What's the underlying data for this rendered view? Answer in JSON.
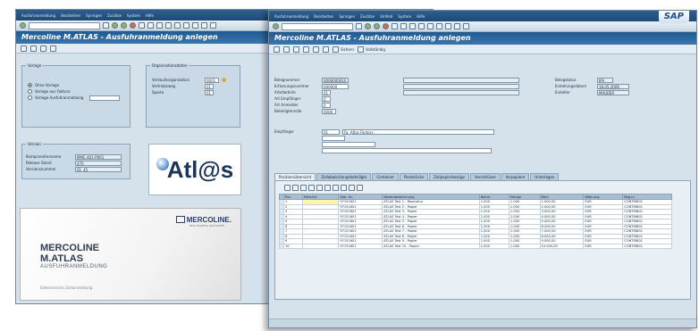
{
  "back_window": {
    "menu": [
      "Ausfuhranmeldung",
      "Bearbeiten",
      "Springen",
      "Zusätze",
      "System",
      "Hilfe"
    ],
    "title": "Mercoline M.ATLAS - Ausfuhranmeldung anlegen",
    "vorlage": {
      "group_title": "Vorlage",
      "options": [
        "Ohne Vorlage",
        "Vorlage aus Faktura",
        "Vorlage Ausfuhranmeldung"
      ],
      "selected": 0
    },
    "org": {
      "group_title": "Organisationsdaten",
      "fields": [
        {
          "label": "Verkaufsorganisation",
          "value": "0001"
        },
        {
          "label": "Vertriebsweg",
          "value": "01"
        },
        {
          "label": "Sparte",
          "value": "01"
        }
      ]
    },
    "vers": {
      "group_title": "Version",
      "fields": [
        {
          "label": "Komponentenname",
          "value": "MMC-401-P001"
        },
        {
          "label": "Release Stand",
          "value": "470"
        },
        {
          "label": "Versionsnummer",
          "value": "01_45"
        }
      ]
    },
    "atlas_logo": "Atl@s",
    "splash": {
      "brand_line1": "MERCOLINE",
      "brand_line2": "M.ATLAS",
      "brand_sub": "AUSFUHRANMELDUNG",
      "logo": "MERCOLINE.",
      "tagline": "DEN PROZESS GESTALTEN",
      "footer": "Elektronische Zollanmeldung"
    }
  },
  "front_window": {
    "menu": [
      "Ausfuhranmeldung",
      "Bearbeiten",
      "Springen",
      "Zusätze",
      "Umfeld",
      "System",
      "Hilfe"
    ],
    "sap_logo": "SAP",
    "title": "Mercoline M.ATLAS - Ausfuhranmeldung anlegen",
    "app_toolbar": [
      "Sichern",
      "Vollständig"
    ],
    "header_fields": [
      {
        "label": "Belegnummer",
        "value": "0000000010"
      },
      {
        "label": "Erfassungsnummer",
        "value": "000000"
      },
      {
        "label": "Artefaktinfo",
        "value": "01"
      },
      {
        "label": "Art Empfänger",
        "value": "0"
      },
      {
        "label": "Art Anmelder",
        "value": "0"
      },
      {
        "label": "Beteiligtenrolle",
        "value": "0000"
      }
    ],
    "right_fields": [
      {
        "label": "Belegstatus",
        "value": "IPA"
      },
      {
        "label": "Erstellungsdatum",
        "value": "18.05.2006"
      },
      {
        "label": "Ersteller",
        "value": "MAURER"
      }
    ],
    "party": {
      "label": "Empfänger",
      "number": "01",
      "name": "Fa. Atlas Factory"
    },
    "tabs": [
      "Positionsübersicht",
      "Zollabwicklungsbeteiligte",
      "Container",
      "Packstücke",
      "Zollpapierbezüge",
      "Verschlüsse",
      "Vorpapiere",
      "Unterlagen"
    ],
    "columns": [
      "Pos",
      "Material",
      "Stat. Nr.",
      "Warenbezeichnung",
      "Rohm.",
      "Menge",
      "Wert",
      "Währung",
      "Reg.nr."
    ],
    "rows": [
      {
        "pos": "1",
        "mat": "",
        "stat": "97151601",
        "desc": "ATLAS Test 1 - Reparatur",
        "w": "1.000",
        "m": "1.000",
        "v": "1.000,00",
        "cur": "EUR",
        "reg": "CONTRIB01"
      },
      {
        "pos": "2",
        "mat": "",
        "stat": "97151601",
        "desc": "ATLAS Test 2 - Papier",
        "w": "1.000",
        "m": "1.000",
        "v": "2.000,00",
        "cur": "EUR",
        "reg": "CONTRIB01"
      },
      {
        "pos": "3",
        "mat": "",
        "stat": "97151601",
        "desc": "ATLAS Test 3 - Papier",
        "w": "1.000",
        "m": "1.000",
        "v": "3.000,00",
        "cur": "EUR",
        "reg": "CONTRIB01"
      },
      {
        "pos": "4",
        "mat": "",
        "stat": "97151601",
        "desc": "ATLAS Test 4 - Papier",
        "w": "1.000",
        "m": "1.000",
        "v": "4.000,00",
        "cur": "EUR",
        "reg": "CONTRIB01"
      },
      {
        "pos": "5",
        "mat": "",
        "stat": "97151601",
        "desc": "ATLAS Test 5 - Papier",
        "w": "1.000",
        "m": "1.000",
        "v": "5.000,00",
        "cur": "EUR",
        "reg": "CONTRIB01"
      },
      {
        "pos": "6",
        "mat": "",
        "stat": "97151601",
        "desc": "ATLAS Test 6 - Papier",
        "w": "1.000",
        "m": "1.000",
        "v": "6.000,00",
        "cur": "EUR",
        "reg": "CONTRIB01"
      },
      {
        "pos": "7",
        "mat": "",
        "stat": "97151601",
        "desc": "ATLAS Test 7 - Papier",
        "w": "1.000",
        "m": "1.000",
        "v": "7.000,00",
        "cur": "EUR",
        "reg": "CONTRIB01"
      },
      {
        "pos": "8",
        "mat": "",
        "stat": "97151601",
        "desc": "ATLAS Test 8 - Papier",
        "w": "1.000",
        "m": "1.000",
        "v": "8.000,00",
        "cur": "EUR",
        "reg": "CONTRIB01"
      },
      {
        "pos": "9",
        "mat": "",
        "stat": "97151601",
        "desc": "ATLAS Test 9 - Papier",
        "w": "1.000",
        "m": "1.000",
        "v": "9.000,00",
        "cur": "EUR",
        "reg": "CONTRIB01"
      },
      {
        "pos": "10",
        "mat": "",
        "stat": "97151601",
        "desc": "ATLAS Test 10 - Papier",
        "w": "1.000",
        "m": "1.000",
        "v": "10.000,00",
        "cur": "EUR",
        "reg": "CONTRIB01"
      }
    ]
  }
}
